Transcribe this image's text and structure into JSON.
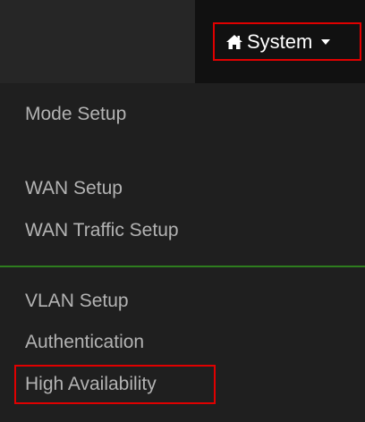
{
  "navbar": {
    "system_label": "System",
    "home_icon": "home-icon",
    "caret_icon": "caret-down-icon"
  },
  "menu": {
    "items": [
      {
        "label": "Mode Setup"
      },
      {
        "label": "WAN Setup"
      },
      {
        "label": "WAN Traffic Setup"
      },
      {
        "label": "VLAN Setup"
      },
      {
        "label": "Authentication"
      },
      {
        "label": "High Availability"
      }
    ]
  },
  "colors": {
    "highlight_border": "#e00000",
    "divider": "#2e7d1e",
    "menu_text": "#b3b3b3",
    "background": "#1f1f1f"
  }
}
